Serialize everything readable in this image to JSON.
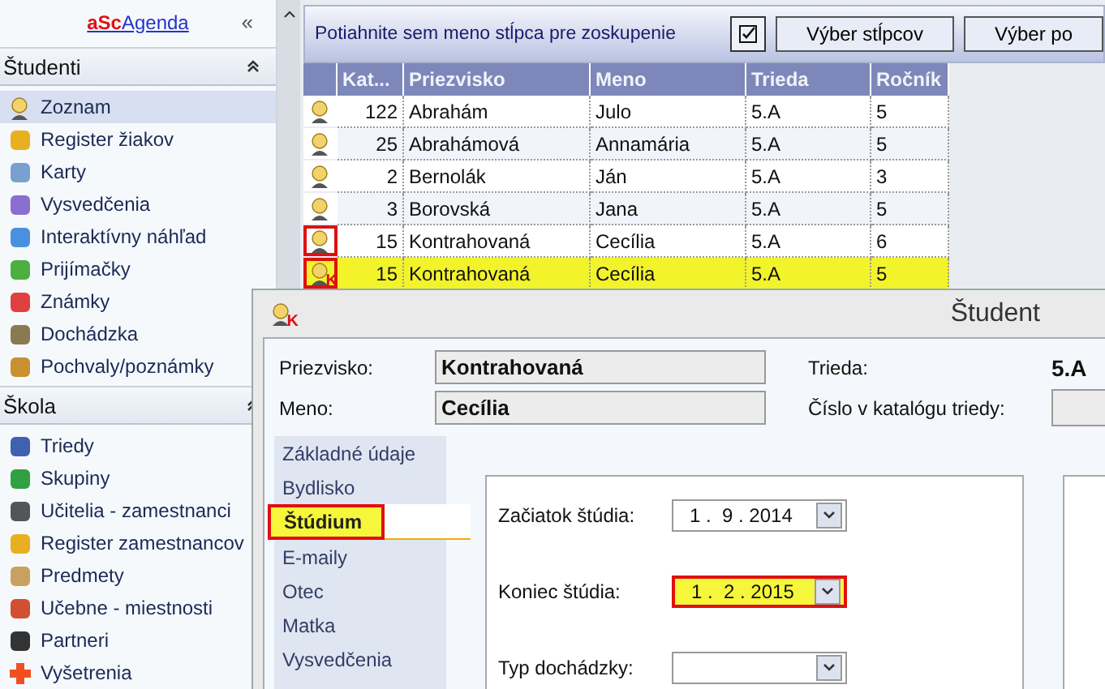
{
  "app_title": {
    "brand": "aSc",
    "name": "Agenda"
  },
  "collapse_button": "«",
  "sidebar": [
    {
      "title": "Študenti",
      "items": [
        {
          "label": "Zoznam",
          "selected": true
        },
        {
          "label": "Register žiakov",
          "selected": false
        },
        {
          "label": "Karty",
          "selected": false
        },
        {
          "label": "Vysvedčenia",
          "selected": false
        },
        {
          "label": "Interaktívny náhľad",
          "selected": false
        },
        {
          "label": "Prijímačky",
          "selected": false
        },
        {
          "label": "Známky",
          "selected": false
        },
        {
          "label": "Dochádzka",
          "selected": false
        },
        {
          "label": "Pochvaly/poznámky",
          "selected": false
        }
      ]
    },
    {
      "title": "Škola",
      "items": [
        {
          "label": "Triedy",
          "selected": false
        },
        {
          "label": "Skupiny",
          "selected": false
        },
        {
          "label": "Učitelia - zamestnanci",
          "selected": false
        },
        {
          "label": "Register zamestnancov",
          "selected": false
        },
        {
          "label": "Predmety",
          "selected": false
        },
        {
          "label": "Učebne - miestnosti",
          "selected": false
        },
        {
          "label": "Partneri",
          "selected": false
        },
        {
          "label": "Vyšetrenia",
          "selected": false
        }
      ]
    }
  ],
  "grid": {
    "group_hint": "Potiahnite sem meno stĺpca pre zoskupenie",
    "buttons": [
      "Výber stĺpcov",
      "Výber po"
    ],
    "columns": [
      "Kat...",
      "Priezvisko",
      "Meno",
      "Trieda",
      "Ročník"
    ],
    "rows": [
      {
        "cells": [
          "122",
          "Abrahám",
          "Julo",
          "5.A",
          "5"
        ],
        "highlighted": false,
        "marked": false
      },
      {
        "cells": [
          "25",
          "Abrahámová",
          "Annamária",
          "5.A",
          "5"
        ],
        "highlighted": false,
        "marked": false
      },
      {
        "cells": [
          "2",
          "Bernolák",
          "Ján",
          "5.A",
          "3"
        ],
        "highlighted": false,
        "marked": false
      },
      {
        "cells": [
          "3",
          "Borovská",
          "Jana",
          "5.A",
          "5"
        ],
        "highlighted": false,
        "marked": false
      },
      {
        "cells": [
          "15",
          "Kontrahovaná",
          "Cecília",
          "5.A",
          "6"
        ],
        "highlighted": false,
        "marked": true
      },
      {
        "cells": [
          "15",
          "Kontrahovaná",
          "Cecília",
          "5.A",
          "5"
        ],
        "highlighted": true,
        "marked": true,
        "badge": "K"
      }
    ]
  },
  "dialog": {
    "icon_badge": "K",
    "title": "Študent",
    "surname": {
      "label": "Priezvisko:",
      "value": "Kontrahovaná"
    },
    "name": {
      "label": "Meno:",
      "value": "Cecília"
    },
    "class": {
      "label": "Trieda:",
      "value": "5.A"
    },
    "catalog": {
      "label": "Číslo v katalógu triedy:"
    },
    "tabs": [
      {
        "label": "Základné údaje",
        "selected": false
      },
      {
        "label": "Bydlisko",
        "selected": false
      },
      {
        "label": "Štúdium",
        "selected": true
      },
      {
        "label": "E-maily",
        "selected": false
      },
      {
        "label": "Otec",
        "selected": false
      },
      {
        "label": "Matka",
        "selected": false
      },
      {
        "label": "Vysvedčenia",
        "selected": false
      }
    ],
    "fields": [
      {
        "label": "Začiatok štúdia:",
        "value": "1 .  9 . 2014",
        "highlighted": false
      },
      {
        "label": "Koniec štúdia:",
        "value": "1 .  2 . 2015",
        "highlighted": true
      },
      {
        "label": "Typ dochádzky:",
        "highlighted": false
      }
    ]
  }
}
